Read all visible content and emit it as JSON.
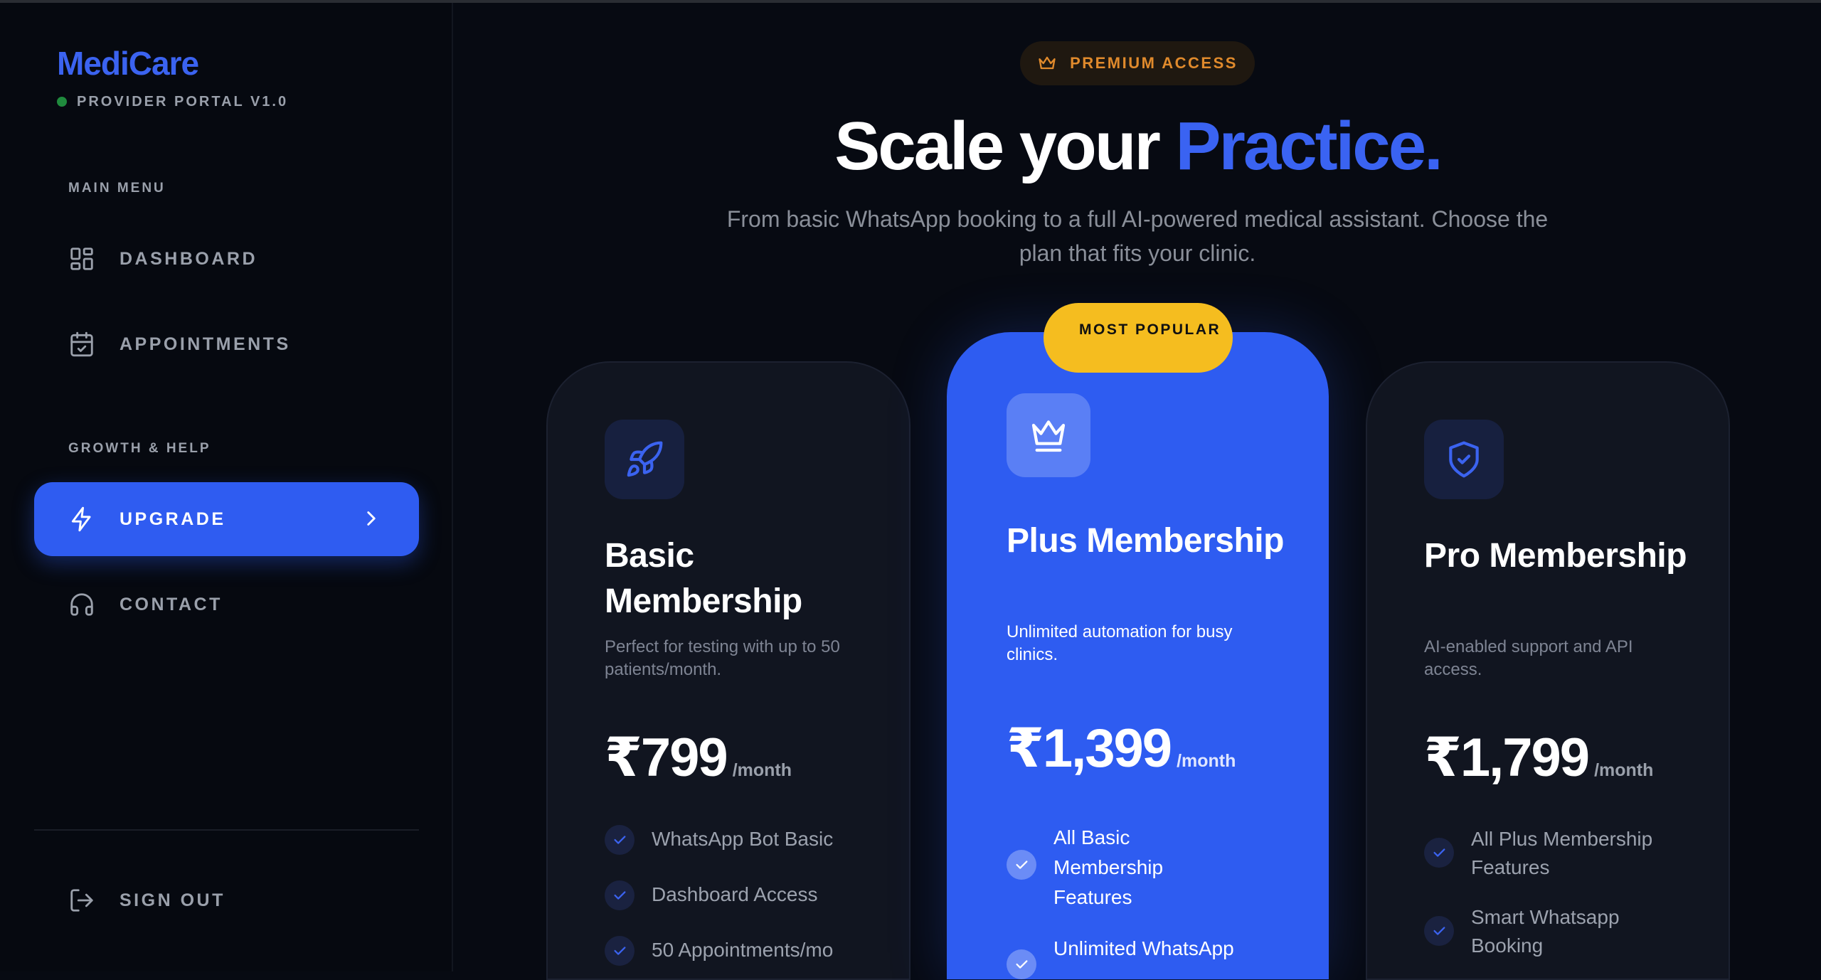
{
  "sidebar": {
    "brand": "MediCare",
    "portal_label": "PROVIDER PORTAL V1.0",
    "sections": {
      "main_menu": "MAIN MENU",
      "growth_help": "GROWTH & HELP"
    },
    "items": [
      {
        "label": "DASHBOARD",
        "icon": "grid-icon"
      },
      {
        "label": "APPOINTMENTS",
        "icon": "calendar-check-icon"
      },
      {
        "label": "UPGRADE",
        "icon": "lightning-icon",
        "active": true
      },
      {
        "label": "CONTACT",
        "icon": "headphones-icon"
      }
    ],
    "sign_out": {
      "label": "SIGN OUT",
      "icon": "logout-icon"
    }
  },
  "main": {
    "badge": {
      "label": "PREMIUM ACCESS",
      "icon": "crown-icon"
    },
    "headline": {
      "part1": "Scale your ",
      "accent": "Practice."
    },
    "subtitle": "From basic WhatsApp booking to a full AI-powered medical assistant. Choose the plan that fits your clinic.",
    "plans": [
      {
        "title": "Basic Membership",
        "icon": "rocket-icon",
        "description": "Perfect for testing with up to 50 patients/month.",
        "price": "₹799",
        "period": "/month",
        "features": [
          "WhatsApp Bot Basic",
          "Dashboard Access",
          "50 Appointments/mo"
        ]
      },
      {
        "title": "Plus Membership",
        "icon": "crown-icon",
        "badge": "MOST POPULAR",
        "description": "Unlimited automation for busy clinics.",
        "price": "₹1,399",
        "period": "/month",
        "features": [
          "All Basic Membership Features",
          "Unlimited WhatsApp"
        ]
      },
      {
        "title": "Pro Membership",
        "icon": "shield-check-icon",
        "description": "AI-enabled support and API access.",
        "price": "₹1,799",
        "period": "/month",
        "features": [
          "All Plus Membership Features",
          "Smart Whatsapp Booking"
        ]
      }
    ]
  },
  "colors": {
    "accent": "#2f5cf1",
    "brand": "#3b63f0",
    "popular_badge": "#f5bd1f",
    "premium_text": "#e08a2c",
    "background": "#070a12"
  }
}
